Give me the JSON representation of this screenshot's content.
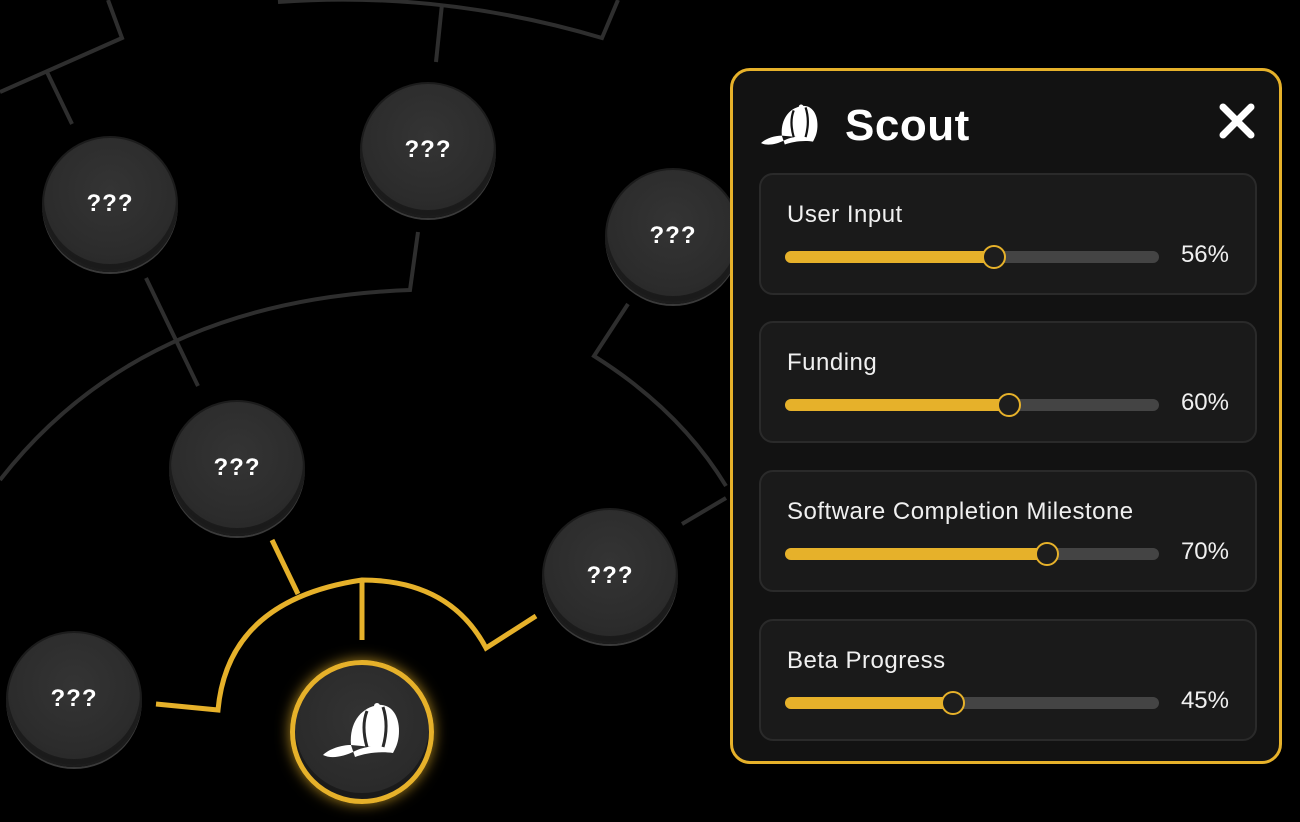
{
  "tree": {
    "locked_label": "???",
    "nodes": [
      {
        "id": "node-top-left",
        "label": "???"
      },
      {
        "id": "node-top-center",
        "label": "???"
      },
      {
        "id": "node-right-edge",
        "label": "???"
      },
      {
        "id": "node-mid-left",
        "label": "???"
      },
      {
        "id": "node-mid-right",
        "label": "???"
      },
      {
        "id": "node-bottom-left",
        "label": "???"
      }
    ],
    "selected_node": {
      "name": "Scout",
      "icon": "baseball-cap-icon"
    },
    "accent_color": "#e6b12a",
    "line_color": "#2e2e2e"
  },
  "panel": {
    "title": "Scout",
    "icon": "baseball-cap-icon",
    "close_icon": "close-icon",
    "stats": [
      {
        "label": "User Input",
        "value": 0.56,
        "display": "56%"
      },
      {
        "label": "Funding",
        "value": 0.6,
        "display": "60%"
      },
      {
        "label": "Software Completion Milestone",
        "value": 0.7,
        "display": "70%"
      },
      {
        "label": "Beta Progress",
        "value": 0.45,
        "display": "45%"
      }
    ]
  }
}
